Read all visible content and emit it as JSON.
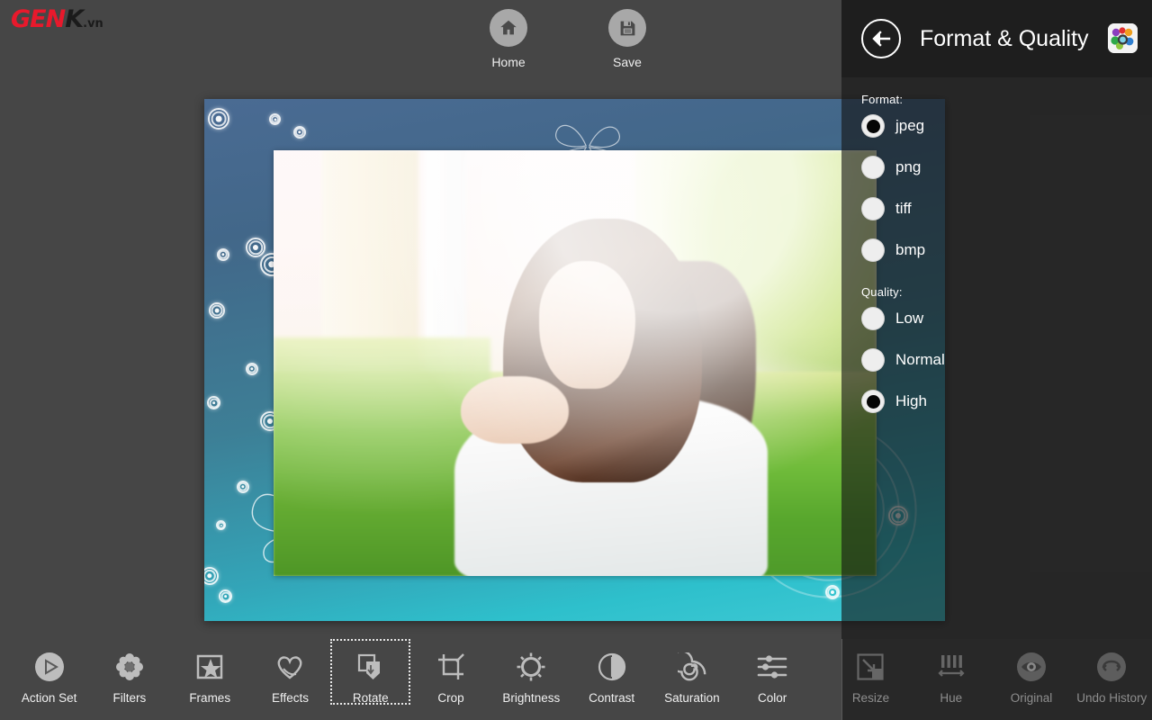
{
  "brand": {
    "part1": "GEN",
    "part2": "K",
    "part3": ".vn"
  },
  "topbar": {
    "buttons": [
      {
        "label": "Home",
        "icon": "home-icon"
      },
      {
        "label": "Save",
        "icon": "save-floppy-icon"
      }
    ]
  },
  "panel": {
    "title": "Format & Quality",
    "back_icon": "back-arrow-icon",
    "app_icon": "app-logo-icon",
    "format": {
      "label": "Format:",
      "options": [
        {
          "label": "jpeg",
          "selected": true
        },
        {
          "label": "png",
          "selected": false
        },
        {
          "label": "tiff",
          "selected": false
        },
        {
          "label": "bmp",
          "selected": false
        }
      ]
    },
    "quality": {
      "label": "Quality:",
      "options": [
        {
          "label": "Low",
          "selected": false
        },
        {
          "label": "Normal",
          "selected": false
        },
        {
          "label": "High",
          "selected": true
        }
      ]
    }
  },
  "toolbar": {
    "tools": [
      {
        "label": "Action Set",
        "icon": "play-circle-icon",
        "selected": false,
        "dimmed": false
      },
      {
        "label": "Filters",
        "icon": "flower-icon",
        "selected": false,
        "dimmed": false
      },
      {
        "label": "Frames",
        "icon": "frame-star-icon",
        "selected": false,
        "dimmed": false
      },
      {
        "label": "Effects",
        "icon": "heart-icon",
        "selected": false,
        "dimmed": false
      },
      {
        "label": "Rotate",
        "icon": "rotate-icon",
        "selected": true,
        "dimmed": false
      },
      {
        "label": "Crop",
        "icon": "crop-icon",
        "selected": false,
        "dimmed": false
      },
      {
        "label": "Brightness",
        "icon": "sun-icon",
        "selected": false,
        "dimmed": false
      },
      {
        "label": "Contrast",
        "icon": "contrast-circle-icon",
        "selected": false,
        "dimmed": false
      },
      {
        "label": "Saturation",
        "icon": "spiral-icon",
        "selected": false,
        "dimmed": false
      },
      {
        "label": "Color",
        "icon": "sliders-icon",
        "selected": false,
        "dimmed": false
      },
      {
        "label": "Resize",
        "icon": "resize-icon",
        "selected": false,
        "dimmed": true
      },
      {
        "label": "Hue",
        "icon": "hue-bars-icon",
        "selected": false,
        "dimmed": true
      },
      {
        "label": "Original",
        "icon": "eye-icon",
        "selected": false,
        "dimmed": true
      },
      {
        "label": "Undo History",
        "icon": "undo-history-icon",
        "selected": false,
        "dimmed": true
      }
    ]
  },
  "colors": {
    "chrome": "#464646",
    "panel_header": "#1e1e1e",
    "accent_red": "#e8192c",
    "icon_gray": "#bdbdbd",
    "text": "#f0f0f0"
  }
}
